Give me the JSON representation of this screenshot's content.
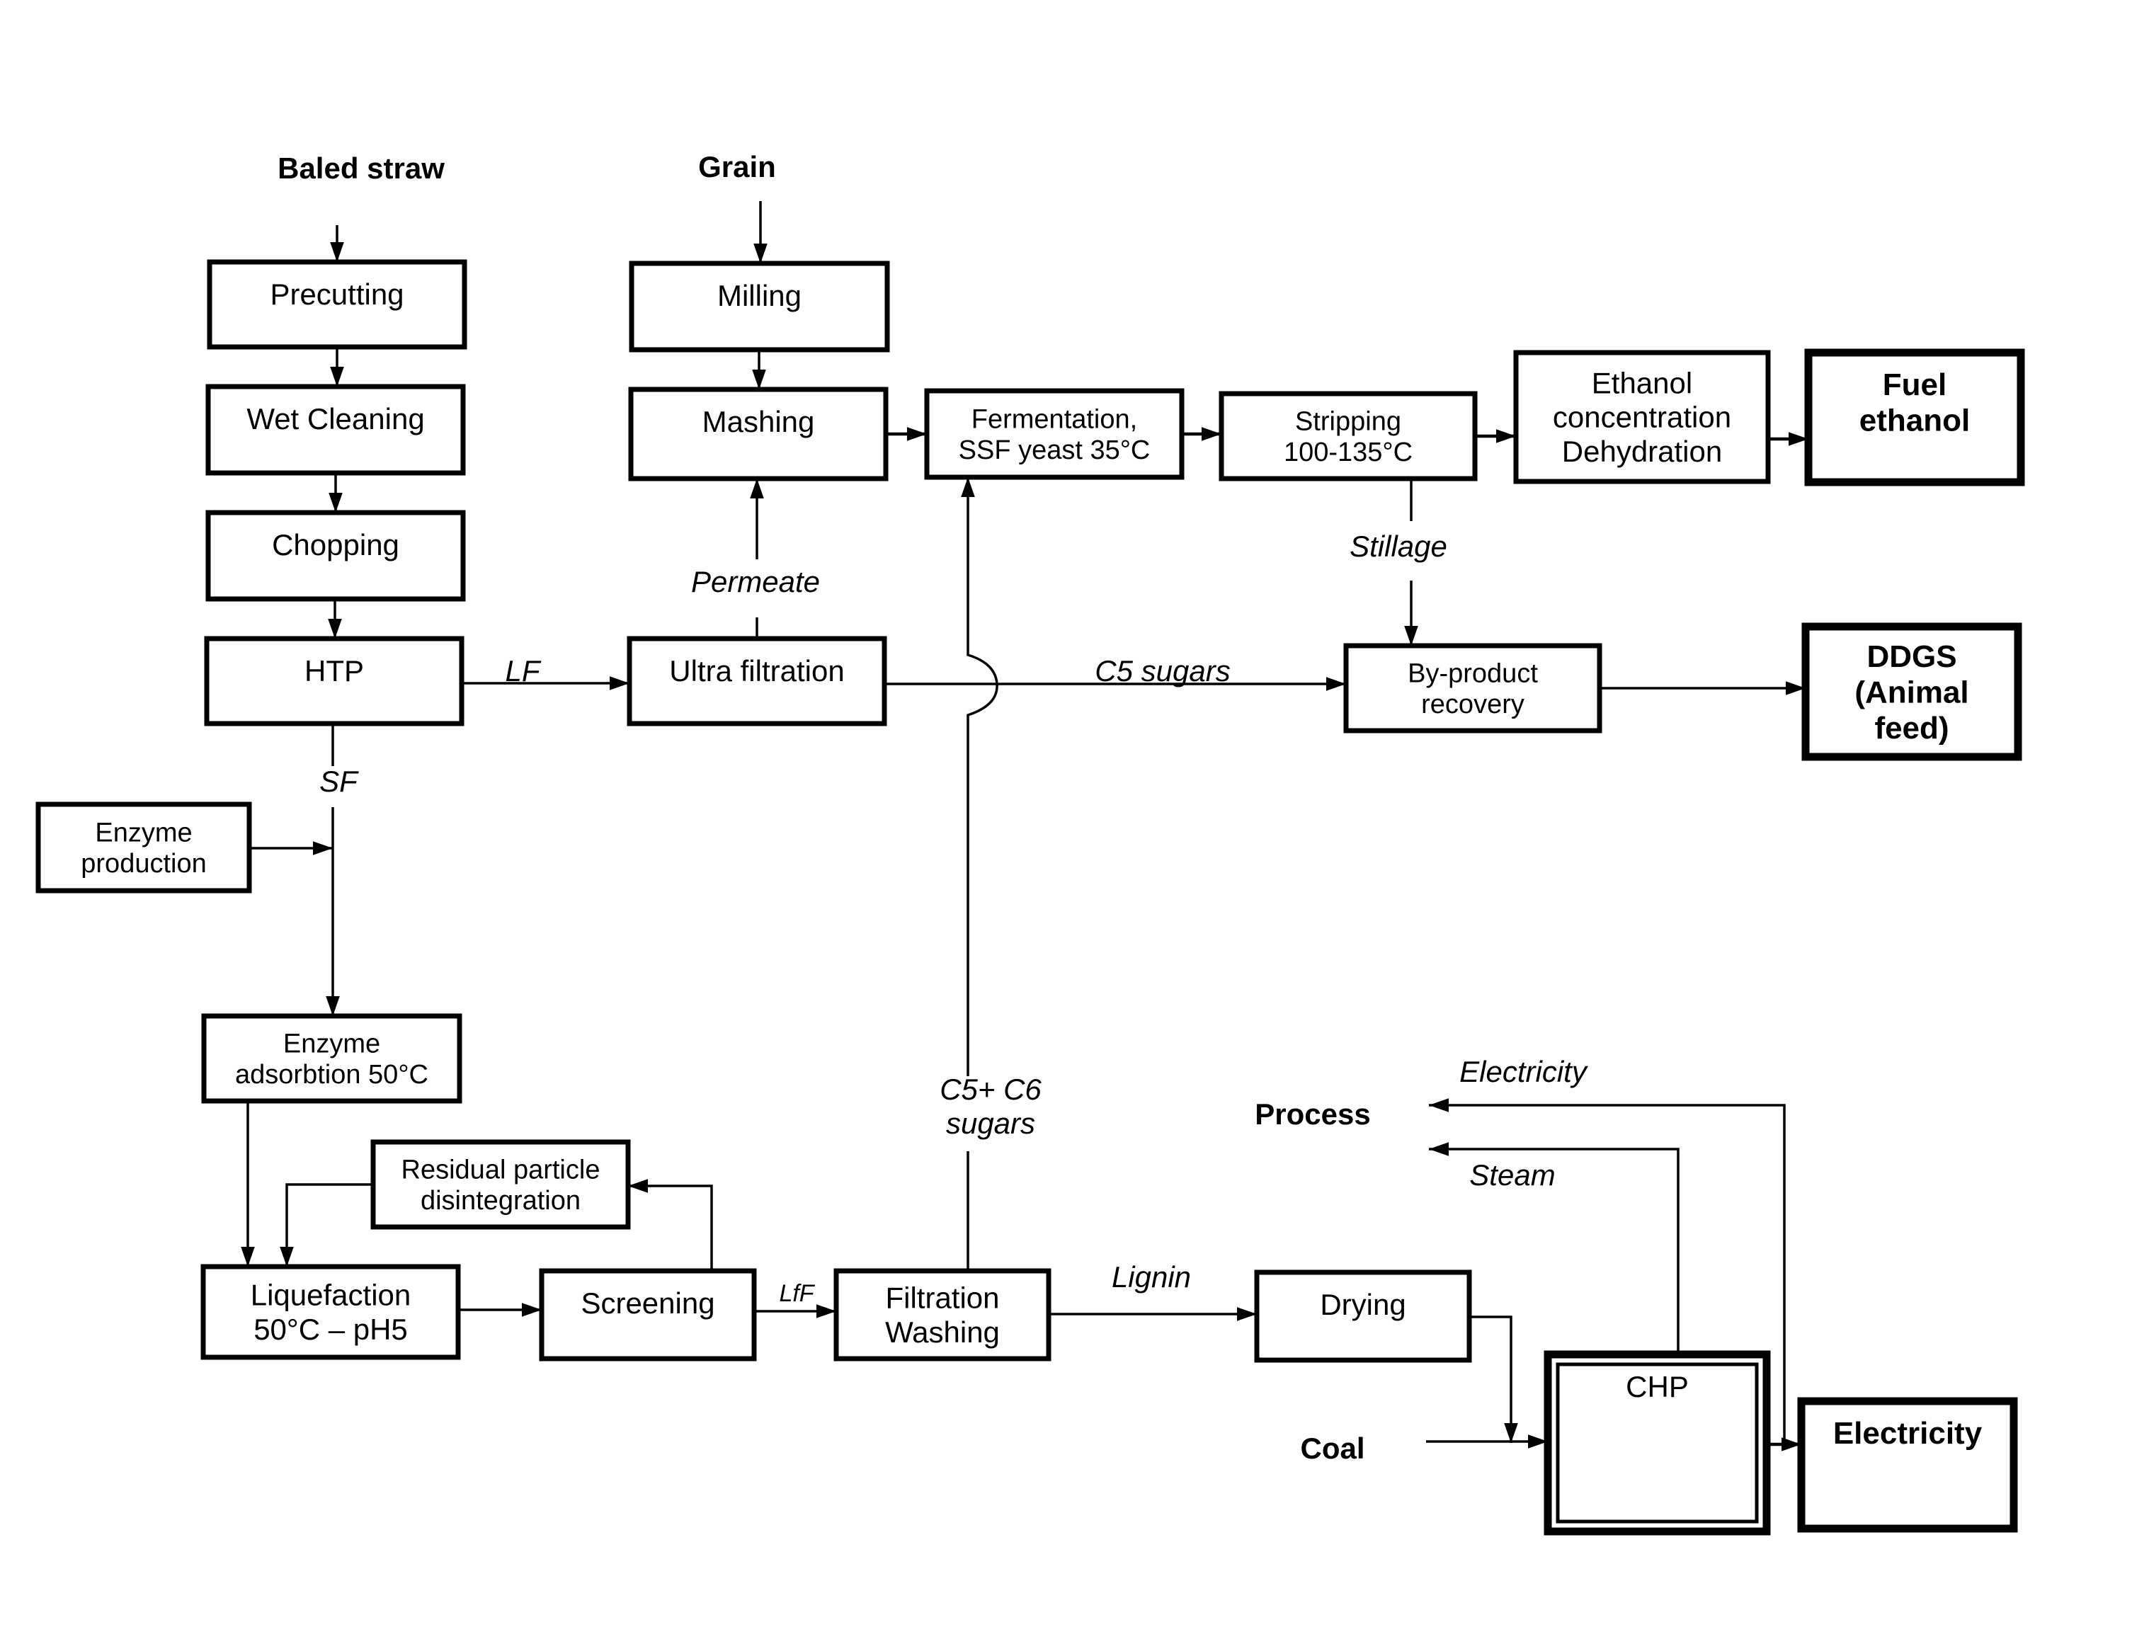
{
  "diagram": {
    "type": "process-flow",
    "colors": {
      "line": "#000000",
      "background": "#ffffff"
    },
    "inputs": {
      "baled_straw": "Baled straw",
      "grain": "Grain",
      "coal": "Coal",
      "process": "Process"
    },
    "boxes": {
      "precutting": [
        "Precutting"
      ],
      "wet_cleaning": [
        "Wet Cleaning"
      ],
      "chopping": [
        "Chopping"
      ],
      "htp": [
        "HTP"
      ],
      "milling": [
        "Milling"
      ],
      "mashing": [
        "Mashing"
      ],
      "ultra_filtration": [
        "Ultra filtration"
      ],
      "fermentation": [
        "Fermentation,",
        "SSF yeast 35°C"
      ],
      "stripping": [
        "Stripping",
        "100-135°C"
      ],
      "ethanol_concentration": [
        "Ethanol",
        "concentration",
        "Dehydration"
      ],
      "fuel_ethanol": [
        "Fuel",
        "ethanol"
      ],
      "byproduct_recovery": [
        "By-product",
        "recovery"
      ],
      "ddgs": [
        "DDGS",
        "(Animal",
        "feed)"
      ],
      "enzyme_production": [
        "Enzyme",
        "production"
      ],
      "enzyme_adsorbtion": [
        "Enzyme",
        "adsorbtion 50°C"
      ],
      "residual_particle": [
        "Residual particle",
        "disintegration"
      ],
      "liquefaction": [
        "Liquefaction",
        "50°C – pH5"
      ],
      "screening": [
        "Screening"
      ],
      "filtration_washing": [
        "Filtration",
        "Washing"
      ],
      "drying": [
        "Drying"
      ],
      "chp": [
        "CHP"
      ],
      "electricity": [
        "Electricity"
      ]
    },
    "flow_labels": {
      "lf": "LF",
      "sf": "SF",
      "permeate": "Permeate",
      "c5_sugars": "C5 sugars",
      "stillage": "Stillage",
      "c5_c6_sugars_line1": "C5+ C6",
      "c5_c6_sugars_line2": "sugars",
      "lff": "LfF",
      "lignin": "Lignin",
      "electricity_flow": "Electricity",
      "steam_flow": "Steam"
    }
  }
}
